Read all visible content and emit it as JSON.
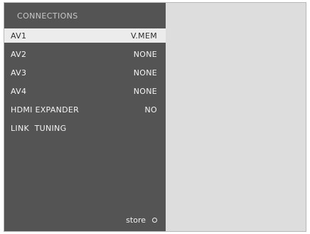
{
  "menu": {
    "title": "CONNECTIONS",
    "items": [
      {
        "label": "AV1",
        "value": "V.MEM"
      },
      {
        "label": "AV2",
        "value": "NONE"
      },
      {
        "label": "AV3",
        "value": "NONE"
      },
      {
        "label": "AV4",
        "value": "NONE"
      },
      {
        "label": "HDMI EXPANDER",
        "value": "NO"
      },
      {
        "label": "LINK  TUNING",
        "value": ""
      }
    ],
    "selected_index": 0
  },
  "store": {
    "label": "store",
    "button_icon": "circle-icon"
  },
  "colors": {
    "panel": "#545454",
    "highlight": "#ececec",
    "background": "#dddddd",
    "text": "#f4f4f4"
  }
}
